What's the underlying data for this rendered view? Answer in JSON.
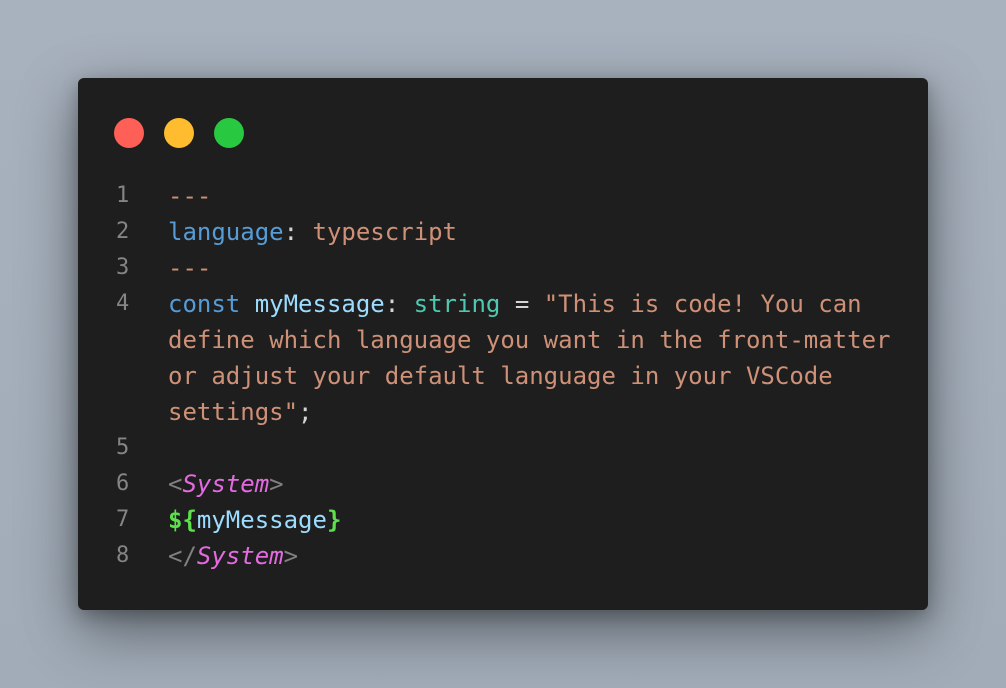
{
  "window": {
    "controls": [
      {
        "name": "close",
        "color": "#fe5f57"
      },
      {
        "name": "minimize",
        "color": "#febc2e"
      },
      {
        "name": "maximize",
        "color": "#28c840"
      }
    ]
  },
  "code": {
    "line_numbers": [
      "1",
      "2",
      "3",
      "4",
      "5",
      "6",
      "7",
      "8"
    ],
    "line1": {
      "text": "---"
    },
    "line2": {
      "key": "language",
      "colon": ":",
      "value": "typescript"
    },
    "line3": {
      "text": "---"
    },
    "line4": {
      "keyword": "const",
      "identifier": "myMessage",
      "colon": ":",
      "type": "string",
      "equals": "=",
      "string": "\"This is code! You can define which language you want in the front-matter or adjust your default language in your VSCode settings\"",
      "semicolon": ";"
    },
    "line6": {
      "open_bracket": "<",
      "tag": "System",
      "close_bracket": ">"
    },
    "line7": {
      "interp_open": "${",
      "identifier": "myMessage",
      "interp_close": "}"
    },
    "line8": {
      "open_bracket": "</",
      "tag": "System",
      "close_bracket": ">"
    }
  }
}
